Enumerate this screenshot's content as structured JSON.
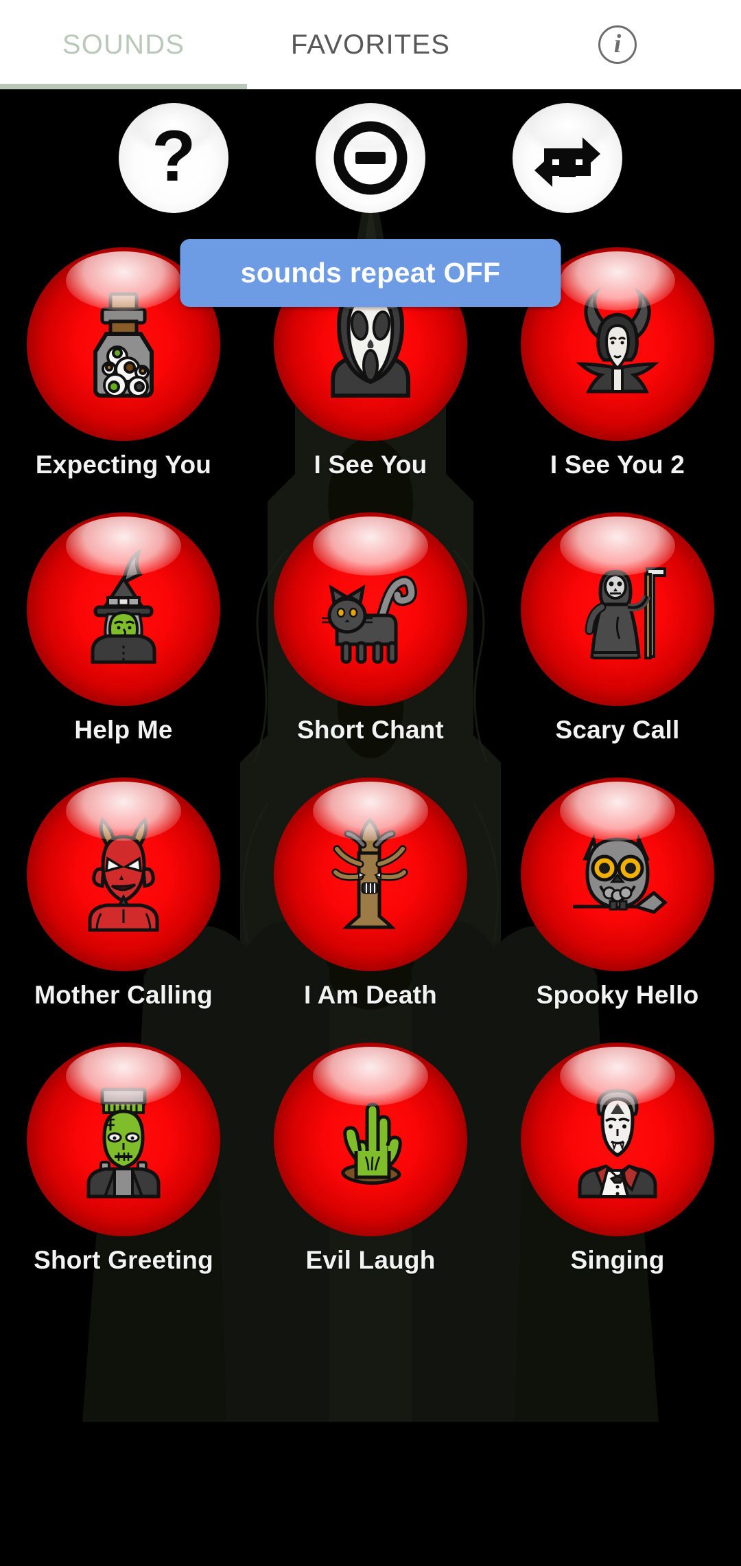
{
  "tabs": {
    "items": [
      {
        "label": "SOUNDS",
        "active": true
      },
      {
        "label": "FAVORITES",
        "active": false
      }
    ],
    "info_icon": "i",
    "active_color": "#b9c8b9",
    "inactive_color": "#585858"
  },
  "controls": [
    {
      "name": "help-button",
      "icon": "question-mark-icon",
      "glyph": "?"
    },
    {
      "name": "stop-button",
      "icon": "stop-sound-icon",
      "glyph": ""
    },
    {
      "name": "repeat-button",
      "icon": "repeat-icon",
      "glyph": ""
    }
  ],
  "toast": {
    "message": "sounds repeat OFF",
    "background": "#6d9ce4",
    "text_color": "#ffffff"
  },
  "theme": {
    "orb_color": "#ff0d0d",
    "background": "#000000",
    "label_color": "#f2f2f2"
  },
  "sounds": [
    {
      "label": "Expecting You",
      "icon": "eyeball-jar-icon"
    },
    {
      "label": "I See You",
      "icon": "ghostface-mask-icon"
    },
    {
      "label": "I See You 2",
      "icon": "horned-villain-icon"
    },
    {
      "label": "Help Me",
      "icon": "witch-icon"
    },
    {
      "label": "Short Chant",
      "icon": "black-cat-icon"
    },
    {
      "label": "Scary Call",
      "icon": "grim-reaper-icon"
    },
    {
      "label": "Mother Calling",
      "icon": "red-devil-icon"
    },
    {
      "label": "I Am Death",
      "icon": "dead-tree-icon"
    },
    {
      "label": "Spooky Hello",
      "icon": "owl-icon"
    },
    {
      "label": "Short Greeting",
      "icon": "frankenstein-icon"
    },
    {
      "label": "Evil Laugh",
      "icon": "zombie-hand-icon"
    },
    {
      "label": "Singing",
      "icon": "dracula-icon"
    }
  ]
}
